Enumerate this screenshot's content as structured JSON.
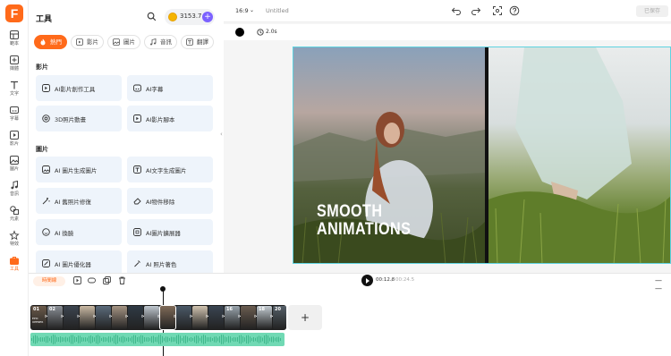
{
  "brand": {
    "logo_letter": "F",
    "accent": "#ff6a1a"
  },
  "rail": [
    {
      "label": "範本",
      "icon": "template-icon"
    },
    {
      "label": "媒體",
      "icon": "media-icon"
    },
    {
      "label": "文字",
      "icon": "text-icon"
    },
    {
      "label": "字幕",
      "icon": "subtitle-icon"
    },
    {
      "label": "影片",
      "icon": "video-icon"
    },
    {
      "label": "圖片",
      "icon": "image-icon"
    },
    {
      "label": "音訊",
      "icon": "audio-icon"
    },
    {
      "label": "元素",
      "icon": "elements-icon"
    },
    {
      "label": "特效",
      "icon": "effects-icon"
    },
    {
      "label": "工具",
      "icon": "tools-icon"
    }
  ],
  "panel": {
    "title": "工具",
    "credits": "3153.7",
    "tabs": [
      {
        "label": "熱門",
        "icon": "fire-icon"
      },
      {
        "label": "影片",
        "icon": "video-icon"
      },
      {
        "label": "圖片",
        "icon": "image-icon"
      },
      {
        "label": "音訊",
        "icon": "music-icon"
      },
      {
        "label": "翻譯",
        "icon": "translate-icon"
      }
    ],
    "section_video": "影片",
    "video_tools": [
      "AI影片創作工具",
      "AI字幕",
      "3D照片動畫",
      "AI影片腳本"
    ],
    "section_image": "圖片",
    "image_tools": [
      "AI 圖片生成圖片",
      "AI文字生成圖片",
      "AI 舊照片修復",
      "AI物件移除",
      "AI 換臉",
      "AI圖片擴展器",
      "AI 圖片優化器",
      "AI 照片著色"
    ]
  },
  "topbar": {
    "ratio": "16:9",
    "title": "Untitled",
    "export": "已保存"
  },
  "editor": {
    "duration": "2.0s",
    "canvas_text_line1": "SMOOTH",
    "canvas_text_line2": "ANIMATIONS"
  },
  "timeline": {
    "sequence_label": "時間線",
    "current_time": "00:12.8",
    "separator": "/",
    "total_time": "00:24.5",
    "zoom_symbol": "— —",
    "add_label": "+",
    "clip_numbers": [
      "01",
      "02",
      "",
      "",
      "",
      "",
      "",
      "",
      "",
      "",
      "",
      "",
      "16",
      "",
      "18",
      "20"
    ],
    "clip_badge": "EPIC OPENER",
    "clip_colors": [
      "#6b5a4a",
      "#8a8f96",
      "#3d4550",
      "#c9b9a3",
      "#5b6b7b",
      "#a59483",
      "#2f3a45",
      "#bfc7cf",
      "#7f6a58",
      "#4b5968",
      "#d0c3b0",
      "#3a4552",
      "#9aa5ad",
      "#6a5c50",
      "#c4ccd2",
      "#555f68"
    ]
  }
}
